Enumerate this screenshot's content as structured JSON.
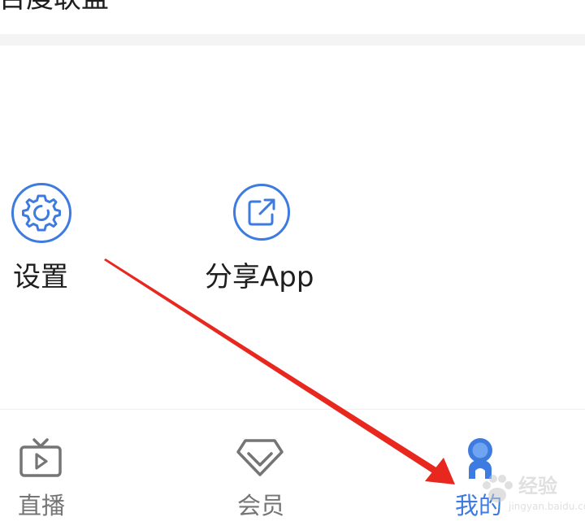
{
  "top_row": {
    "label": "百度联盟"
  },
  "tools": {
    "settings": {
      "label": "设置",
      "icon": "gear-icon"
    },
    "share": {
      "label": "分享App",
      "icon": "share-icon"
    }
  },
  "bottom_nav": {
    "tabs": [
      {
        "label": "直播",
        "icon": "tv-icon"
      },
      {
        "label": "会员",
        "icon": "diamond-icon"
      },
      {
        "label": "我的",
        "icon": "profile-icon"
      }
    ]
  },
  "watermark": {
    "text": "经验",
    "sub": "jingyan.baidu.com"
  },
  "colors": {
    "accent": "#3d7be0",
    "icon_gray": "#757575",
    "text_dark": "#1e1e1e",
    "annotation_red": "#e8281e"
  }
}
